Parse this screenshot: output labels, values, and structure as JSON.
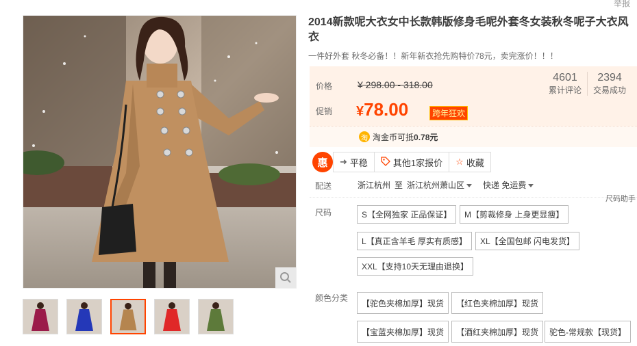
{
  "report": "举报",
  "product": {
    "title": "2014新款呢大衣女中长款韩版修身毛呢外套冬女装秋冬呢子大衣风衣",
    "subtitle": "一件好外套 秋冬必备！！新年新衣抢先购特价78元，卖完涨价！！！"
  },
  "price": {
    "label": "价格",
    "original": "¥ 298.00 - 318.00",
    "promo_label": "促销",
    "currency": "¥",
    "current": "78.00",
    "promo_badge": "跨年狂欢",
    "coin_text": "淘金币可抵",
    "coin_value": "0.78元",
    "coin_icon": "淘"
  },
  "stats": [
    {
      "value": "4601",
      "label": "累计评论"
    },
    {
      "value": "2394",
      "label": "交易成功"
    }
  ],
  "actions": {
    "hui": "惠",
    "trend": "平稳",
    "other_quotes": "其他1家报价",
    "favorite": "收藏"
  },
  "delivery": {
    "label": "配送",
    "from": "浙江杭州",
    "to_word": "至",
    "to": "浙江杭州萧山区",
    "shipping": "快递 免运费"
  },
  "size_help": "尺码助手",
  "size": {
    "label": "尺码",
    "options": [
      "S【全网独家 正品保证】",
      "M【剪裁修身 上身更显瘦】",
      "L【真正含羊毛 厚实有质感】",
      "XL【全国包邮 闪电发货】",
      "XXL【支持10天无理由退换】"
    ]
  },
  "color": {
    "label": "颜色分类",
    "options": [
      "【驼色夹棉加厚】现货",
      "【红色夹棉加厚】现货",
      "【宝蓝夹棉加厚】现货",
      "【酒红夹棉加厚】现货",
      "驼色-常规款【现货】"
    ]
  },
  "thumbnails": [
    "酒红",
    "宝蓝",
    "驼色",
    "红色",
    "军绿"
  ],
  "colors": {
    "accent": "#ff4400",
    "price_bg": "#fff2e8",
    "thumb_colors": [
      "#9b1b4a",
      "#2438b8",
      "#b5854f",
      "#e02828",
      "#5d7a3a"
    ]
  }
}
